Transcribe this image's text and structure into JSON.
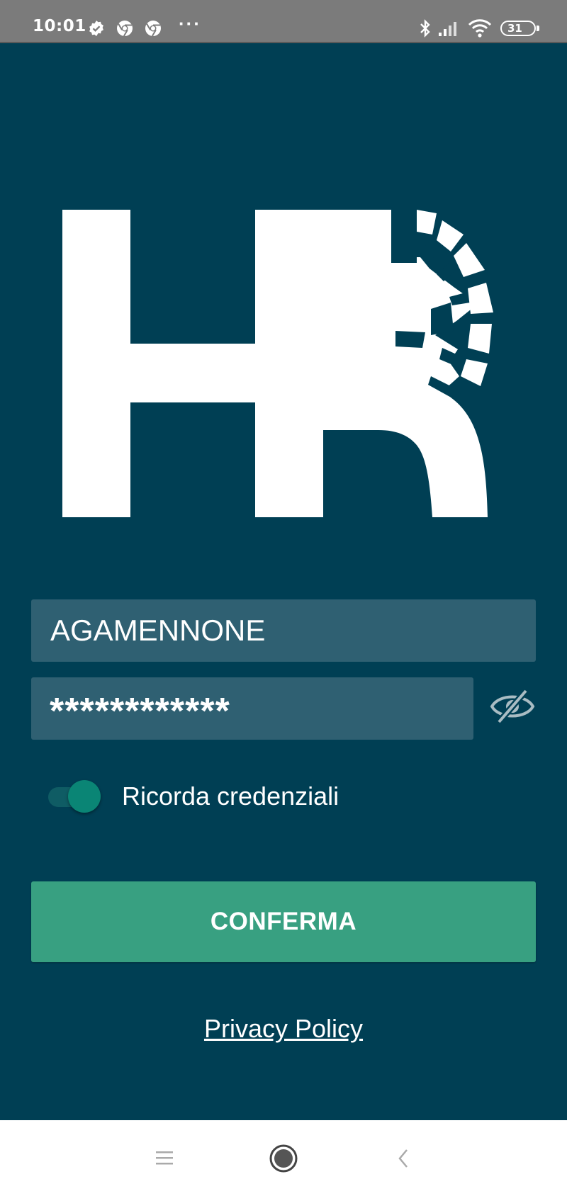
{
  "status_bar": {
    "time": "10:01",
    "battery_level": "31",
    "more_indicator": "···",
    "icons": [
      "verified-icon",
      "chrome-icon",
      "chrome-icon",
      "bluetooth-icon",
      "signal-icon",
      "wifi-icon",
      "battery-icon"
    ]
  },
  "login": {
    "username_value": "AGAMENNONE",
    "password_value": "************",
    "remember_label": "Ricorda credenziali",
    "remember_checked": true,
    "confirm_label": "CONFERMA",
    "privacy_label": "Privacy Policy"
  },
  "nav_bar": {
    "icons": [
      "menu-icon",
      "home-icon",
      "back-icon"
    ]
  },
  "colors": {
    "background": "#003f54",
    "field": "#2f6072",
    "accent": "#38a081",
    "toggle_knob": "#0a8575",
    "status_bar": "#7b7b7b"
  }
}
